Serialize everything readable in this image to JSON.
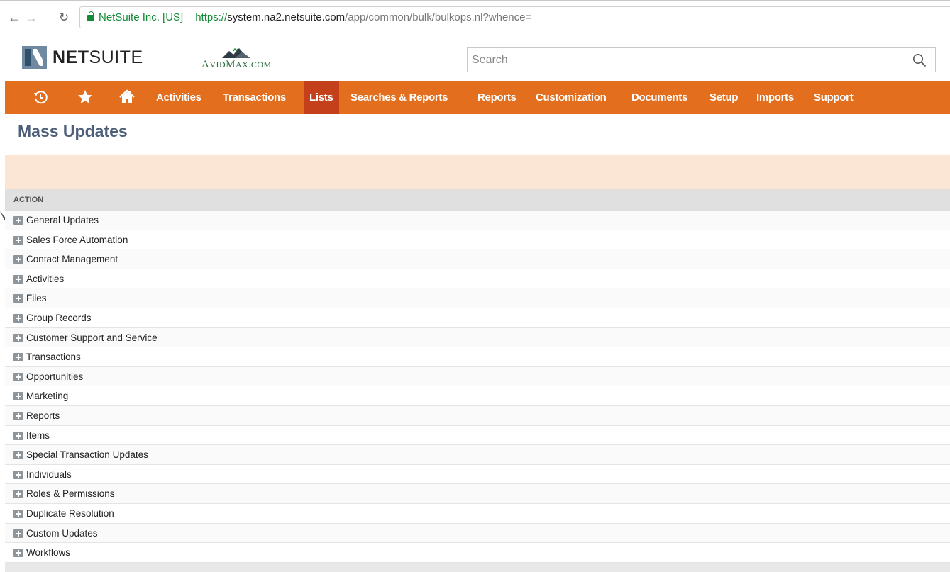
{
  "browser": {
    "site_identity": "NetSuite Inc. [US]",
    "url_proto": "https://",
    "url_host": "system.na2.netsuite.com",
    "url_path": "/app/common/bulk/bulkops.nl?whence="
  },
  "header": {
    "logo_brand_bold": "NET",
    "logo_brand_light": "SUITE",
    "partner_logo_text_1": "A",
    "partner_logo_text_2": "VID",
    "partner_logo_text_3": "M",
    "partner_logo_text_4": "AX.COM",
    "search_placeholder": "Search",
    "search_icon": "search-icon"
  },
  "nav": {
    "icons": [
      "recent-records-icon",
      "star-icon",
      "home-icon"
    ],
    "items": [
      {
        "label": "Activities"
      },
      {
        "label": "Transactions"
      },
      {
        "label": "Lists"
      },
      {
        "label": "Searches & Reports"
      },
      {
        "label": "Reports"
      },
      {
        "label": "Customization"
      },
      {
        "label": "Documents"
      },
      {
        "label": "Setup"
      },
      {
        "label": "Imports"
      },
      {
        "label": "Support"
      }
    ],
    "active": "Lists"
  },
  "page": {
    "title": "Mass Updates",
    "column_header": "ACTION"
  },
  "actions": [
    {
      "label": "General Updates"
    },
    {
      "label": "Sales Force Automation"
    },
    {
      "label": "Contact Management"
    },
    {
      "label": "Activities"
    },
    {
      "label": "Files"
    },
    {
      "label": "Group Records"
    },
    {
      "label": "Customer Support and Service"
    },
    {
      "label": "Transactions"
    },
    {
      "label": "Opportunities"
    },
    {
      "label": "Marketing"
    },
    {
      "label": "Reports"
    },
    {
      "label": "Items"
    },
    {
      "label": "Special Transaction Updates"
    },
    {
      "label": "Individuals"
    },
    {
      "label": "Roles & Permissions"
    },
    {
      "label": "Duplicate Resolution"
    },
    {
      "label": "Custom Updates"
    },
    {
      "label": "Workflows"
    }
  ],
  "colors": {
    "nav_bg": "#e36f1e",
    "nav_active": "#c4401a",
    "title": "#4d5f79",
    "message_band": "#fbe5d5",
    "secure_green": "#138a36"
  }
}
